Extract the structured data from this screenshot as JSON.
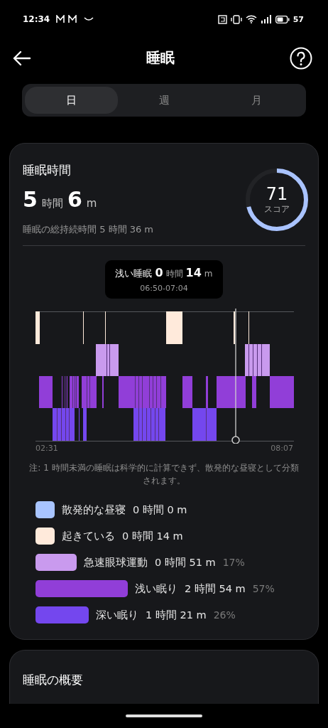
{
  "status_bar": {
    "time": "12:34",
    "battery": "57"
  },
  "header": {
    "title": "睡眠"
  },
  "tabs": [
    {
      "label": "日",
      "selected": true
    },
    {
      "label": "週",
      "selected": false
    },
    {
      "label": "月",
      "selected": false
    }
  ],
  "sleep_card": {
    "title": "睡眠時間",
    "hours": "5",
    "hours_unit": "時間",
    "minutes": "6",
    "minutes_unit": "m",
    "total": "睡眠の総持続時間 5 時間 36 m",
    "score": {
      "value": "71",
      "label": "スコア",
      "level": 0.71
    },
    "tooltip": {
      "stage": "浅い睡眠",
      "hours": "0",
      "hours_unit": "時間",
      "minutes": "14",
      "minutes_unit": "m",
      "range": "06:50-07:04"
    },
    "chart": {
      "start": "02:31",
      "end": "08:07"
    },
    "note": "注: 1 時間未満の睡眠は科学的に計算できず、散発的な昼寝として分類されます。",
    "legend": [
      {
        "label": "散発的な昼寝",
        "duration": "0 時間 0 m",
        "color": "#a8c4ff"
      },
      {
        "label": "起きている",
        "duration": "0 時間 14 m",
        "color": "#ffeadb"
      },
      {
        "label": "急速眼球運動",
        "duration": "0 時間 51 m",
        "percent": "17%",
        "color": "#c99aee"
      },
      {
        "label": "浅い眠り",
        "duration": "2 時間 54 m",
        "percent": "57%",
        "color": "#913ed8"
      },
      {
        "label": "深い眠り",
        "duration": "1 時間 21 m",
        "percent": "26%",
        "color": "#7447ee"
      }
    ]
  },
  "overview_card": {
    "title": "睡眠の概要"
  }
}
